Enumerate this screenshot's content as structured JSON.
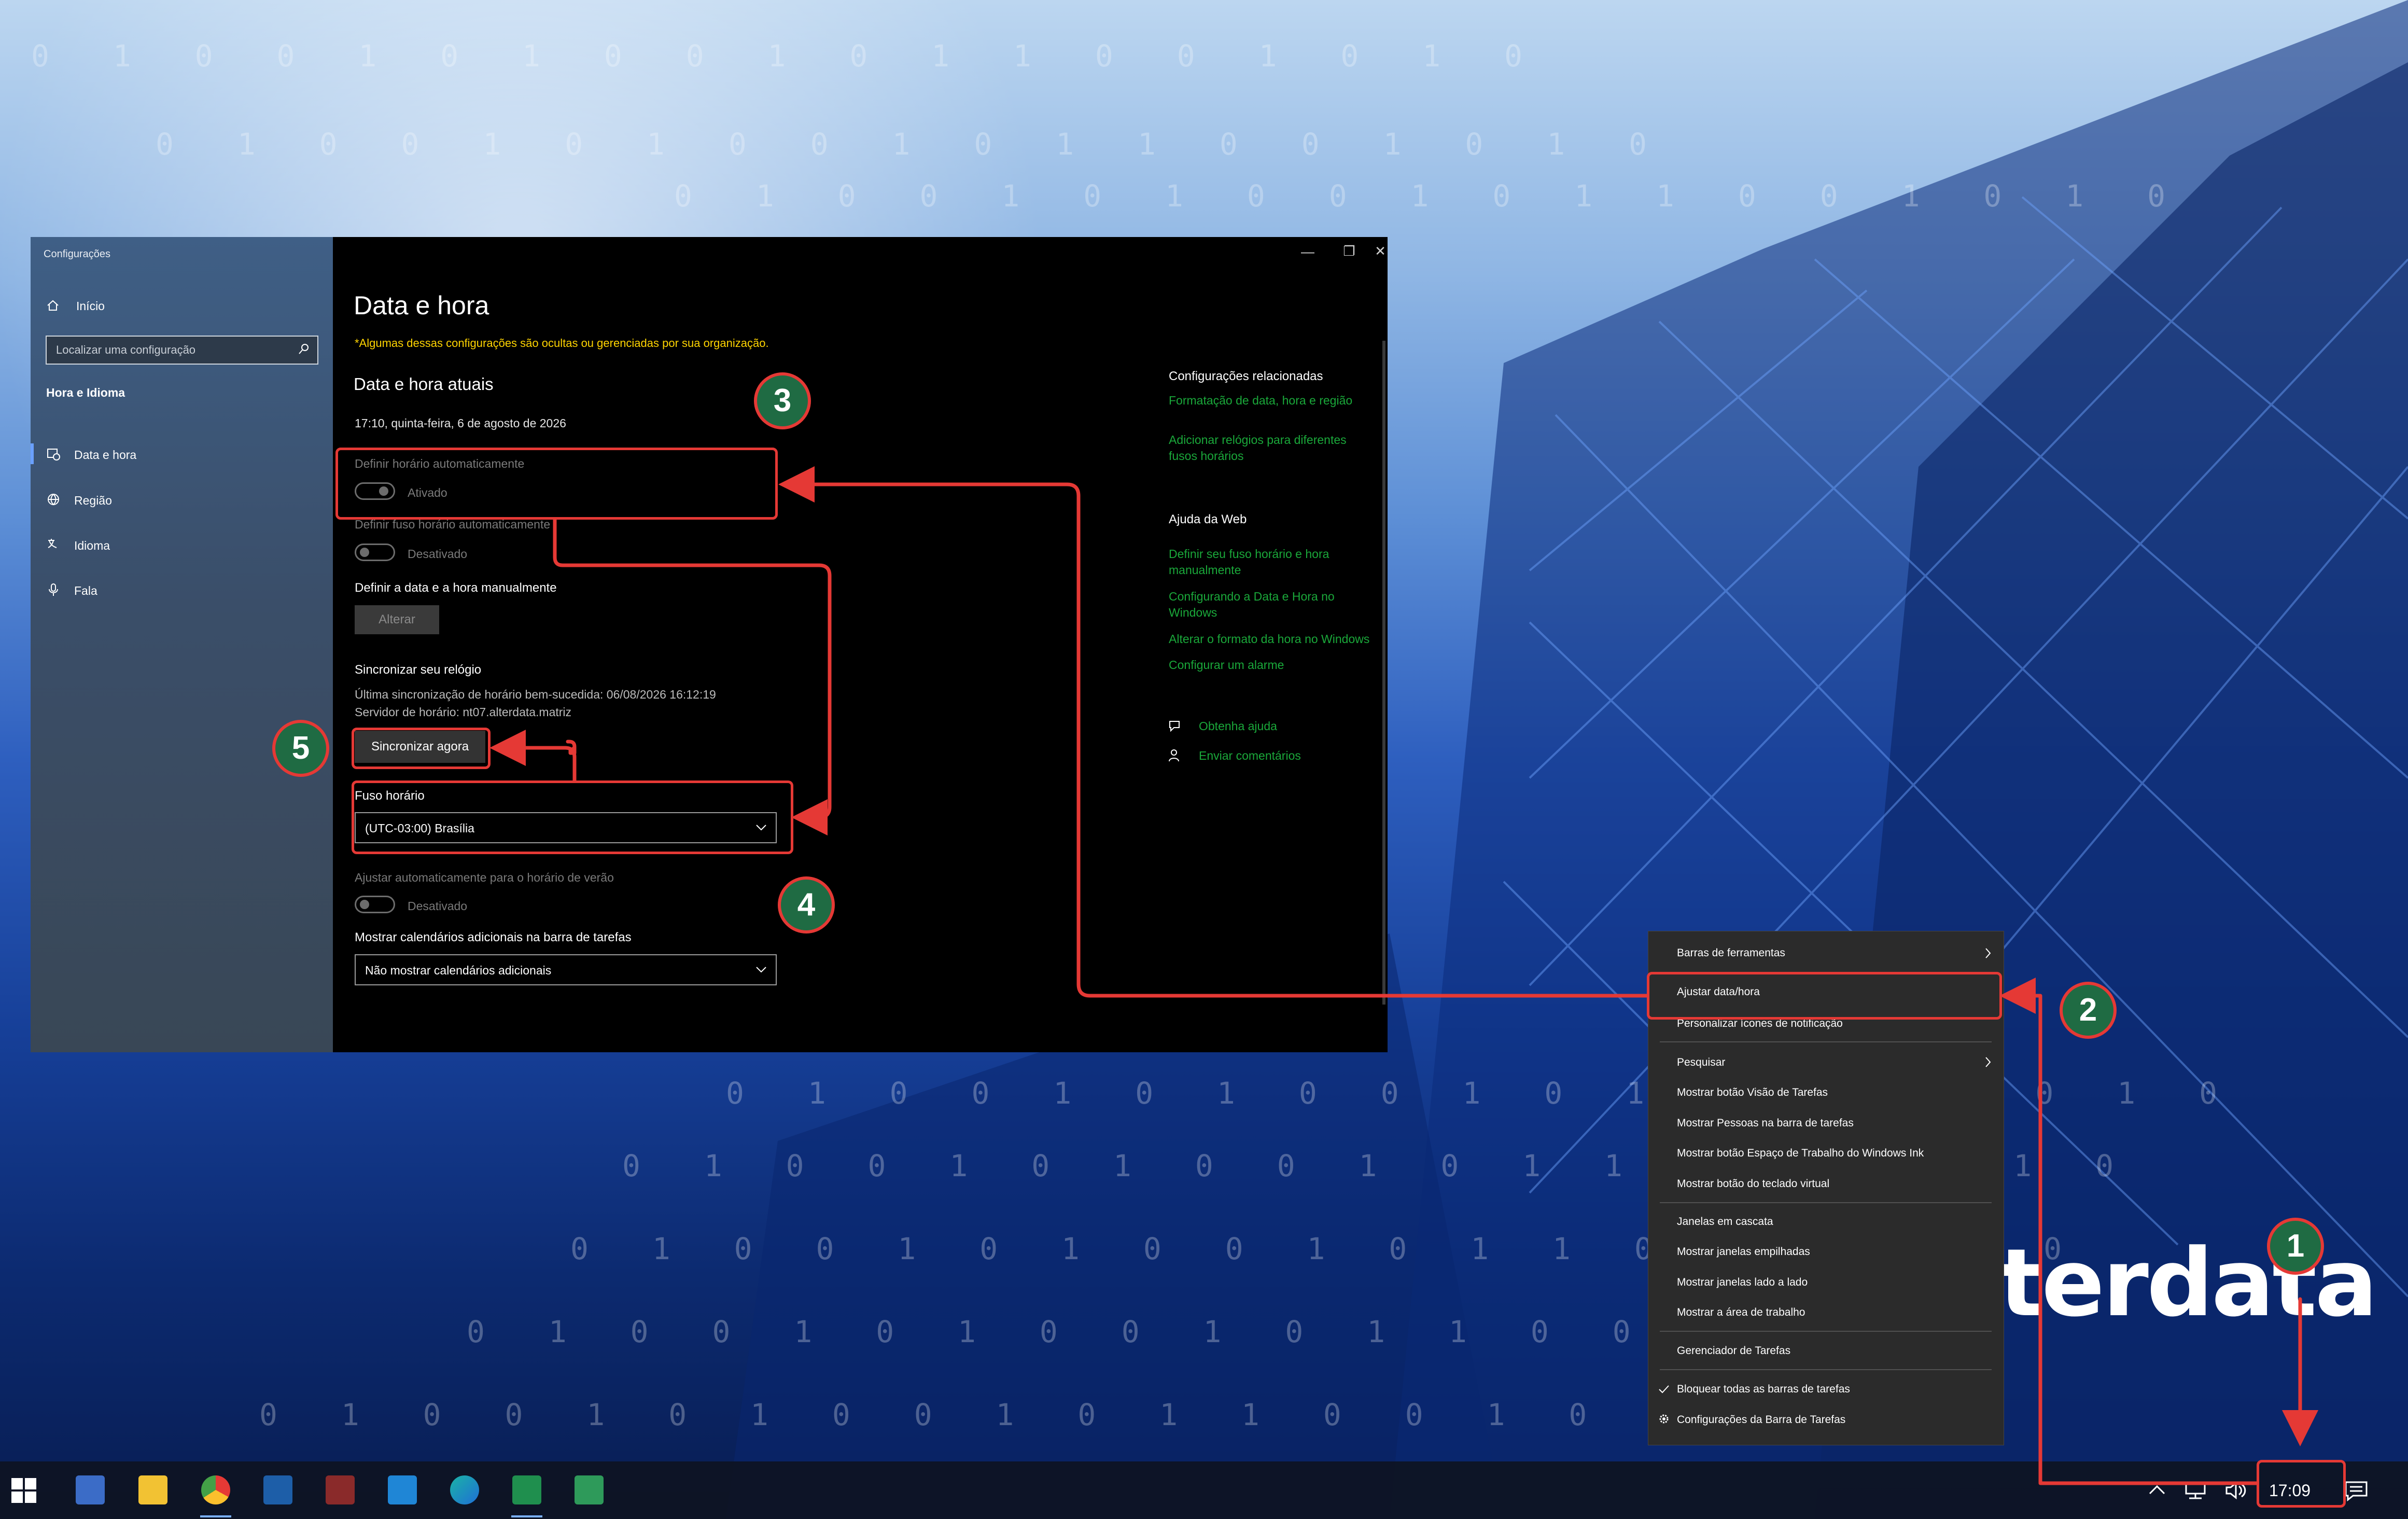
{
  "settings": {
    "app_title": "Configurações",
    "nav": {
      "home": "Início",
      "search_placeholder": "Localizar uma configuração",
      "section": "Hora e Idioma",
      "items": [
        "Data e hora",
        "Região",
        "Idioma",
        "Fala"
      ]
    },
    "page_title": "Data e hora",
    "org_notice": "*Algumas dessas configurações são ocultas ou gerenciadas por sua organização.",
    "current_heading": "Data e hora atuais",
    "current_datetime": "17:10, quinta-feira, 6 de agosto de 2026",
    "auto_time": {
      "label": "Definir horário automaticamente",
      "state": "Ativado"
    },
    "auto_timezone": {
      "label": "Definir fuso horário automaticamente",
      "state": "Desativado"
    },
    "manual": {
      "label": "Definir a data e a hora manualmente",
      "button": "Alterar"
    },
    "sync": {
      "heading": "Sincronizar seu relógio",
      "last_sync": "Última sincronização de horário bem-sucedida: 06/08/2026 16:12:19",
      "server": "Servidor de horário: nt07.alterdata.matriz",
      "button": "Sincronizar agora"
    },
    "timezone": {
      "label": "Fuso horário",
      "value": "(UTC-03:00) Brasília"
    },
    "dst": {
      "label": "Ajustar automaticamente para o horário de verão",
      "state": "Desativado"
    },
    "calendars": {
      "label": "Mostrar calendários adicionais na barra de tarefas",
      "value": "Não mostrar calendários adicionais"
    },
    "related": {
      "heading": "Configurações relacionadas",
      "link1": "Formatação de data, hora e região",
      "link2a": "Adicionar relógios para diferentes",
      "link2b": "fusos horários"
    },
    "web_help": {
      "heading": "Ajuda da Web",
      "l1a": "Definir seu fuso horário e hora",
      "l1b": "manualmente",
      "l2a": "Configurando a Data e Hora no",
      "l2b": "Windows",
      "l3": "Alterar o formato da hora no Windows",
      "l4": "Configurar um alarme"
    },
    "get_help": "Obtenha ajuda",
    "feedback": "Enviar comentários",
    "window_controls": {
      "minimize": "—",
      "maximize": "❐",
      "close": "✕"
    }
  },
  "context_menu": {
    "items": [
      "Barras de ferramentas",
      "Ajustar data/hora",
      "Personalizar ícones de notificação",
      "Pesquisar",
      "Mostrar botão Visão de Tarefas",
      "Mostrar Pessoas na barra de tarefas",
      "Mostrar botão Espaço de Trabalho do Windows Ink",
      "Mostrar botão do teclado virtual",
      "Janelas em cascata",
      "Mostrar janelas empilhadas",
      "Mostrar janelas lado a lado",
      "Mostrar a área de trabalho",
      "Gerenciador de Tarefas",
      "Bloquear todas as barras de tarefas",
      "Configurações da Barra de Tarefas"
    ]
  },
  "taskbar": {
    "clock": "17:09"
  },
  "desktop": {
    "brand_partial": "terdata",
    "digits_row": "0 1 0 0 1 0 1 0 0 1 0 1 1 0 0 1 0 1 0"
  },
  "annotations": [
    "1",
    "2",
    "3",
    "4",
    "5"
  ],
  "colors": {
    "annotation": "#e53935",
    "badge": "#1f6b43",
    "link": "#1aa83a",
    "warning": "#ffd400"
  }
}
